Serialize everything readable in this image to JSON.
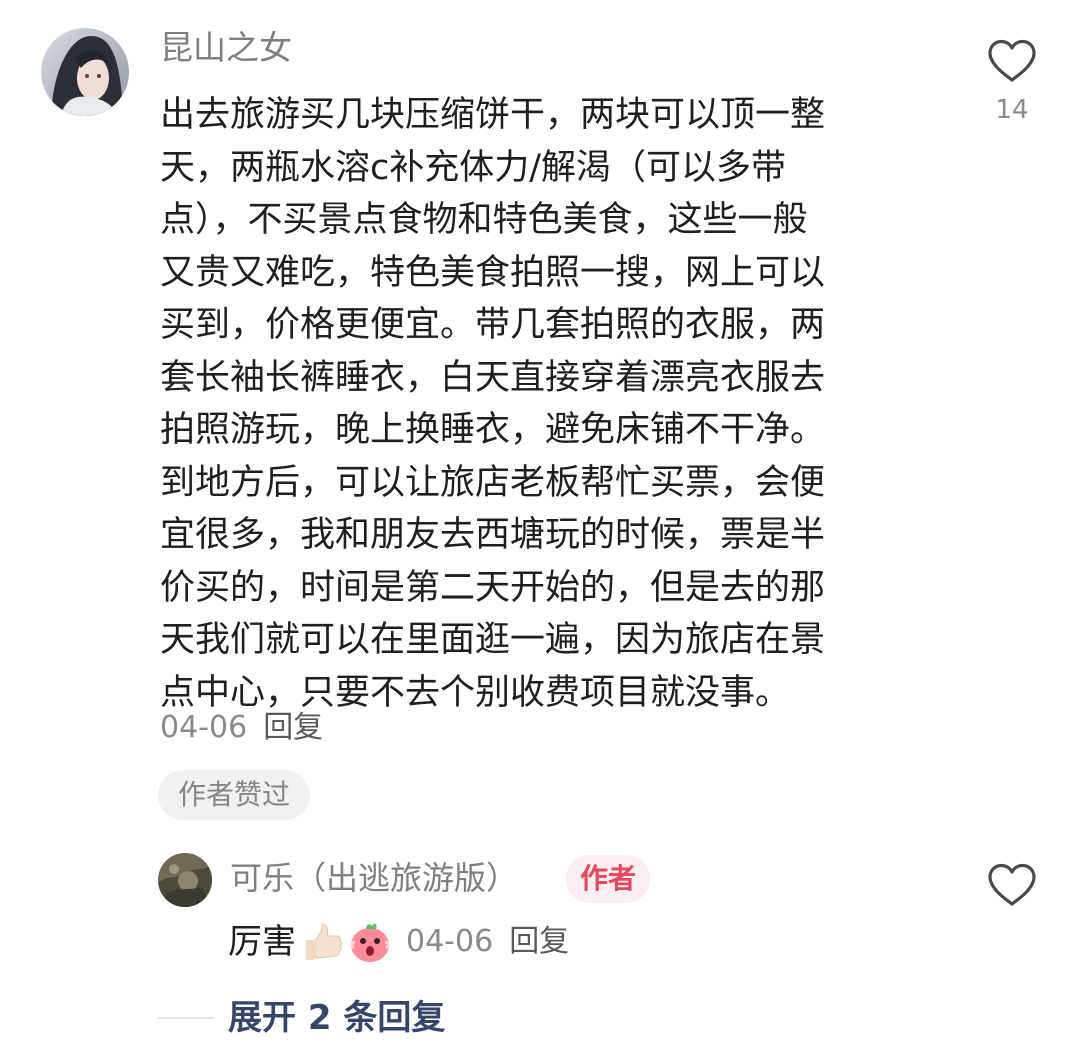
{
  "comment": {
    "username": "昆山之女",
    "body": "出去旅游买几块压缩饼干，两块可以顶一整\n天，两瓶水溶c补充体力/解渴（可以多带\n点），不买景点食物和特色美食，这些一般\n又贵又难吃，特色美食拍照一搜，网上可以\n买到，价格更便宜。带几套拍照的衣服，两\n套长袖长裤睡衣，白天直接穿着漂亮衣服去\n拍照游玩，晚上换睡衣，避免床铺不干净。\n到地方后，可以让旅店老板帮忙买票，会便\n宜很多，我和朋友去西塘玩的时候，票是半\n价买的，时间是第二天开始的，但是去的那\n天我们就可以在里面逛一遍，因为旅店在景\n点中心，只要不去个别收费项目就没事。",
    "date": "04-06",
    "reply_label": "回复",
    "like_count": "14",
    "liked_by_author_badge": "作者赞过",
    "like_icon": "heart-outline-icon"
  },
  "reply": {
    "username": "可乐（出逃旅游版）",
    "author_badge": "作者",
    "text": "厉害",
    "emojis": [
      "thumbs-up-icon",
      "surprised-face-icon"
    ],
    "date": "04-06",
    "reply_label": "回复",
    "like_icon": "heart-outline-icon"
  },
  "expand": {
    "label": "展开 2 条回复"
  },
  "colors": {
    "username": "#7f7f7f",
    "meta": "#8a8a8a",
    "author_badge_text": "#e8465c",
    "author_badge_bg": "#fbeef0",
    "expand_text": "#36466b"
  }
}
